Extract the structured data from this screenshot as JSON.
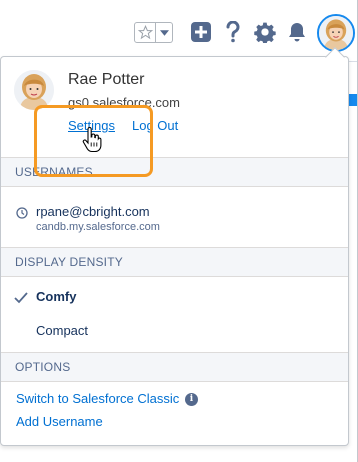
{
  "topbar": {
    "icons": [
      "star-icon",
      "chevron-down-icon",
      "add-icon",
      "help-icon",
      "gear-icon",
      "bell-icon",
      "avatar"
    ]
  },
  "user": {
    "name": "Rae Potter",
    "org": "gs0.salesforce.com",
    "settings_label": "Settings",
    "logout_label": "Log Out"
  },
  "usernames": {
    "heading": "USERNAMES",
    "items": [
      {
        "email": "rpane@cbright.com",
        "domain": "candb.my.salesforce.com"
      }
    ]
  },
  "density": {
    "heading": "DISPLAY DENSITY",
    "options": [
      {
        "label": "Comfy",
        "selected": true
      },
      {
        "label": "Compact",
        "selected": false
      }
    ]
  },
  "options": {
    "heading": "OPTIONS",
    "switch_label": "Switch to Salesforce Classic",
    "add_username_label": "Add Username"
  },
  "colors": {
    "link": "#0070d2",
    "highlight": "#f59a23",
    "section_bg": "#f4f6f9"
  }
}
